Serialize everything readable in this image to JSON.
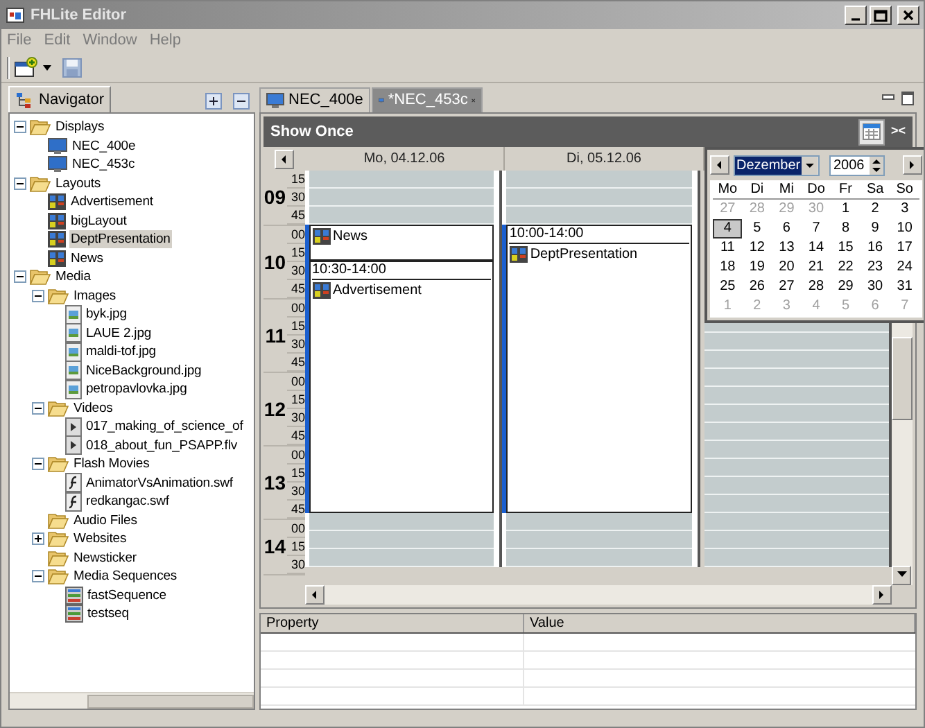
{
  "window": {
    "title": "FHLite Editor"
  },
  "menu": [
    "File",
    "Edit",
    "Window",
    "Help"
  ],
  "navigator": {
    "title": "Navigator"
  },
  "tree": [
    {
      "label": "Displays",
      "kind": "folder",
      "expanded": true,
      "selected": false,
      "children": [
        {
          "label": "NEC_400e",
          "kind": "display",
          "selected": false
        },
        {
          "label": "NEC_453c",
          "kind": "display",
          "selected": false
        }
      ]
    },
    {
      "label": "Layouts",
      "kind": "folder",
      "expanded": true,
      "selected": false,
      "children": [
        {
          "label": "Advertisement",
          "kind": "layout",
          "selected": false
        },
        {
          "label": "bigLayout",
          "kind": "layout",
          "selected": false
        },
        {
          "label": "DeptPresentation",
          "kind": "layout",
          "selected": true
        },
        {
          "label": "News",
          "kind": "layout",
          "selected": false
        }
      ]
    },
    {
      "label": "Media",
      "kind": "folder",
      "expanded": true,
      "selected": false,
      "children": [
        {
          "label": "Images",
          "kind": "folder",
          "expanded": true,
          "selected": false,
          "children": [
            {
              "label": "byk.jpg",
              "kind": "image",
              "selected": false
            },
            {
              "label": "LAUE 2.jpg",
              "kind": "image",
              "selected": false
            },
            {
              "label": "maldi-tof.jpg",
              "kind": "image",
              "selected": false
            },
            {
              "label": "NiceBackground.jpg",
              "kind": "image",
              "selected": false
            },
            {
              "label": "petropavlovka.jpg",
              "kind": "image",
              "selected": false
            }
          ]
        },
        {
          "label": "Videos",
          "kind": "folder",
          "expanded": true,
          "selected": false,
          "children": [
            {
              "label": "017_making_of_science_of",
              "kind": "video",
              "selected": false
            },
            {
              "label": "018_about_fun_PSAPP.flv",
              "kind": "video",
              "selected": false
            }
          ]
        },
        {
          "label": "Flash Movies",
          "kind": "folder",
          "expanded": true,
          "selected": false,
          "children": [
            {
              "label": "AnimatorVsAnimation.swf",
              "kind": "flash",
              "selected": false
            },
            {
              "label": "redkangac.swf",
              "kind": "flash",
              "selected": false
            }
          ]
        },
        {
          "label": "Audio Files",
          "kind": "folder",
          "selected": false
        },
        {
          "label": "Websites",
          "kind": "folder",
          "expanded": false,
          "selected": false
        },
        {
          "label": "Newsticker",
          "kind": "folder",
          "selected": false
        },
        {
          "label": "Media Sequences",
          "kind": "folder",
          "expanded": true,
          "selected": false,
          "children": [
            {
              "label": "fastSequence",
              "kind": "sequence",
              "selected": false
            },
            {
              "label": "testseq",
              "kind": "sequence",
              "selected": false
            }
          ]
        }
      ]
    }
  ],
  "editor_tabs": [
    {
      "label": "NEC_400e",
      "selected": false
    },
    {
      "label": "*NEC_453c",
      "selected": true
    }
  ],
  "schedule": {
    "title": "Show Once",
    "collapse_glyph": "><",
    "hours": [
      {
        "hour": "09",
        "minutes": [
          "15",
          "30",
          "45"
        ]
      },
      {
        "hour": "10",
        "minutes": [
          "00",
          "15",
          "30",
          "45"
        ]
      },
      {
        "hour": "11",
        "minutes": [
          "00",
          "15",
          "30",
          "45"
        ]
      },
      {
        "hour": "12",
        "minutes": [
          "00",
          "15",
          "30",
          "45"
        ]
      },
      {
        "hour": "13",
        "minutes": [
          "00",
          "15",
          "30",
          "45"
        ]
      },
      {
        "hour": "14",
        "minutes": [
          "00",
          "15",
          "30"
        ]
      }
    ],
    "days": [
      {
        "header": "Mo, 04.12.06",
        "events": [
          {
            "label": "News"
          },
          {
            "time": "10:30-14:00",
            "label": "Advertisement"
          }
        ]
      },
      {
        "header": "Di, 05.12.06",
        "events": [
          {
            "time": "10:00-14:00",
            "label": "DeptPresentation"
          }
        ]
      }
    ]
  },
  "date_picker": {
    "month": "Dezember",
    "year": "2006",
    "weekdays": [
      "Mo",
      "Di",
      "Mi",
      "Do",
      "Fr",
      "Sa",
      "So"
    ],
    "weeks": [
      [
        {
          "d": "27",
          "outside": true,
          "selected": false
        },
        {
          "d": "28",
          "outside": true,
          "selected": false
        },
        {
          "d": "29",
          "outside": true,
          "selected": false
        },
        {
          "d": "30",
          "outside": true,
          "selected": false
        },
        {
          "d": "1",
          "outside": false,
          "selected": false
        },
        {
          "d": "2",
          "outside": false,
          "selected": false
        },
        {
          "d": "3",
          "outside": false,
          "selected": false
        }
      ],
      [
        {
          "d": "4",
          "outside": false,
          "selected": true
        },
        {
          "d": "5",
          "outside": false,
          "selected": false
        },
        {
          "d": "6",
          "outside": false,
          "selected": false
        },
        {
          "d": "7",
          "outside": false,
          "selected": false
        },
        {
          "d": "8",
          "outside": false,
          "selected": false
        },
        {
          "d": "9",
          "outside": false,
          "selected": false
        },
        {
          "d": "10",
          "outside": false,
          "selected": false
        }
      ],
      [
        {
          "d": "11",
          "outside": false,
          "selected": false
        },
        {
          "d": "12",
          "outside": false,
          "selected": false
        },
        {
          "d": "13",
          "outside": false,
          "selected": false
        },
        {
          "d": "14",
          "outside": false,
          "selected": false
        },
        {
          "d": "15",
          "outside": false,
          "selected": false
        },
        {
          "d": "16",
          "outside": false,
          "selected": false
        },
        {
          "d": "17",
          "outside": false,
          "selected": false
        }
      ],
      [
        {
          "d": "18",
          "outside": false,
          "selected": false
        },
        {
          "d": "19",
          "outside": false,
          "selected": false
        },
        {
          "d": "20",
          "outside": false,
          "selected": false
        },
        {
          "d": "21",
          "outside": false,
          "selected": false
        },
        {
          "d": "22",
          "outside": false,
          "selected": false
        },
        {
          "d": "23",
          "outside": false,
          "selected": false
        },
        {
          "d": "24",
          "outside": false,
          "selected": false
        }
      ],
      [
        {
          "d": "25",
          "outside": false,
          "selected": false
        },
        {
          "d": "26",
          "outside": false,
          "selected": false
        },
        {
          "d": "27",
          "outside": false,
          "selected": false
        },
        {
          "d": "28",
          "outside": false,
          "selected": false
        },
        {
          "d": "29",
          "outside": false,
          "selected": false
        },
        {
          "d": "30",
          "outside": false,
          "selected": false
        },
        {
          "d": "31",
          "outside": false,
          "selected": false
        }
      ],
      [
        {
          "d": "1",
          "outside": true,
          "selected": false
        },
        {
          "d": "2",
          "outside": true,
          "selected": false
        },
        {
          "d": "3",
          "outside": true,
          "selected": false
        },
        {
          "d": "4",
          "outside": true,
          "selected": false
        },
        {
          "d": "5",
          "outside": true,
          "selected": false
        },
        {
          "d": "6",
          "outside": true,
          "selected": false
        },
        {
          "d": "7",
          "outside": true,
          "selected": false
        }
      ]
    ]
  },
  "properties": {
    "columns": [
      "Property",
      "Value"
    ]
  }
}
